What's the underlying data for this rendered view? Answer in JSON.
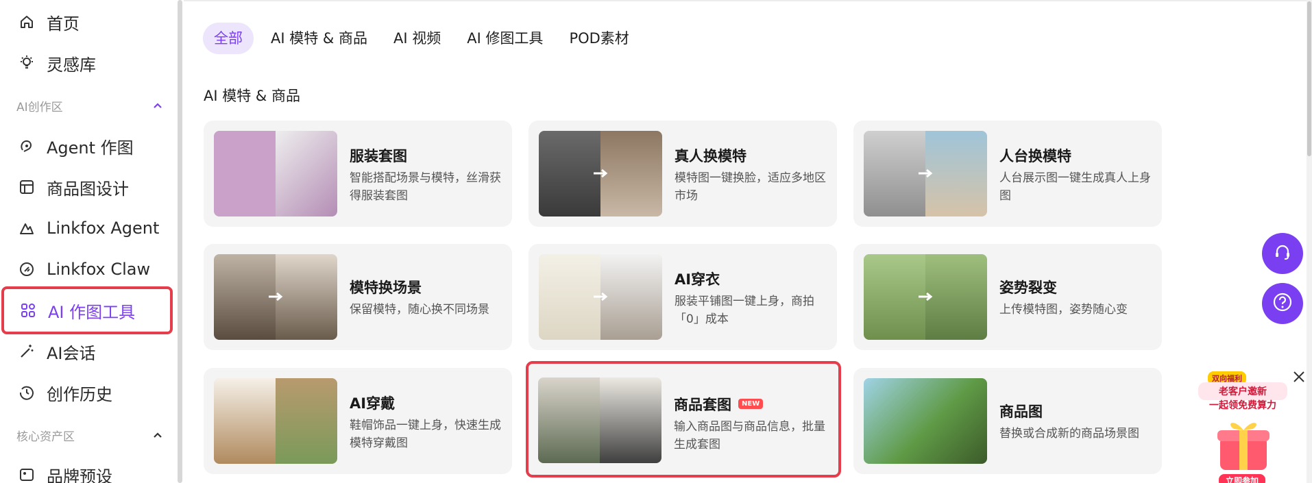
{
  "sidebar": {
    "items": [
      {
        "label": "首页",
        "icon": "home-icon"
      },
      {
        "label": "灵感库",
        "icon": "lightbulb-icon"
      },
      {
        "label": "Agent 作图",
        "icon": "agent-icon"
      },
      {
        "label": "商品图设计",
        "icon": "layout-icon"
      },
      {
        "label": "Linkfox Agent",
        "icon": "linkfox-icon"
      },
      {
        "label": "Linkfox Claw",
        "icon": "claw-icon"
      },
      {
        "label": "AI 作图工具",
        "icon": "tools-icon"
      },
      {
        "label": "AI会话",
        "icon": "magic-wand-icon"
      },
      {
        "label": "创作历史",
        "icon": "history-icon"
      },
      {
        "label": "品牌预设",
        "icon": "brand-icon"
      }
    ],
    "sections": [
      {
        "label": "AI创作区"
      },
      {
        "label": "核心资产区"
      }
    ]
  },
  "tabs": [
    "全部",
    "AI 模特 & 商品",
    "AI 视频",
    "AI 修图工具",
    "POD素材"
  ],
  "section_title": "AI 模特 & 商品",
  "cards": [
    {
      "title": "服装套图",
      "desc": "智能搭配场景与模特，丝滑获得服装套图"
    },
    {
      "title": "真人换模特",
      "desc": "模特图一键换脸，适应多地区市场"
    },
    {
      "title": "人台换模特",
      "desc": "人台展示图一键生成真人上身图"
    },
    {
      "title": "模特换场景",
      "desc": "保留模特，随心换不同场景"
    },
    {
      "title": "AI穿衣",
      "desc": "服装平铺图一键上身，商拍「0」成本"
    },
    {
      "title": "姿势裂变",
      "desc": "上传模特图，姿势随心变"
    },
    {
      "title": "AI穿戴",
      "desc": "鞋帽饰品一键上身，快速生成模特穿戴图"
    },
    {
      "title": "商品套图",
      "desc": "输入商品图与商品信息，批量生成套图",
      "badge": "NEW"
    },
    {
      "title": "商品图",
      "desc": "替换或合成新的商品场景图"
    }
  ],
  "promo": {
    "tag": "双向福利",
    "line1": "老客户邀新",
    "line2": "一起领免费算力",
    "cta": "立即参加"
  },
  "colors": {
    "accent": "#7b3ff2",
    "highlight": "#e43d4b"
  }
}
